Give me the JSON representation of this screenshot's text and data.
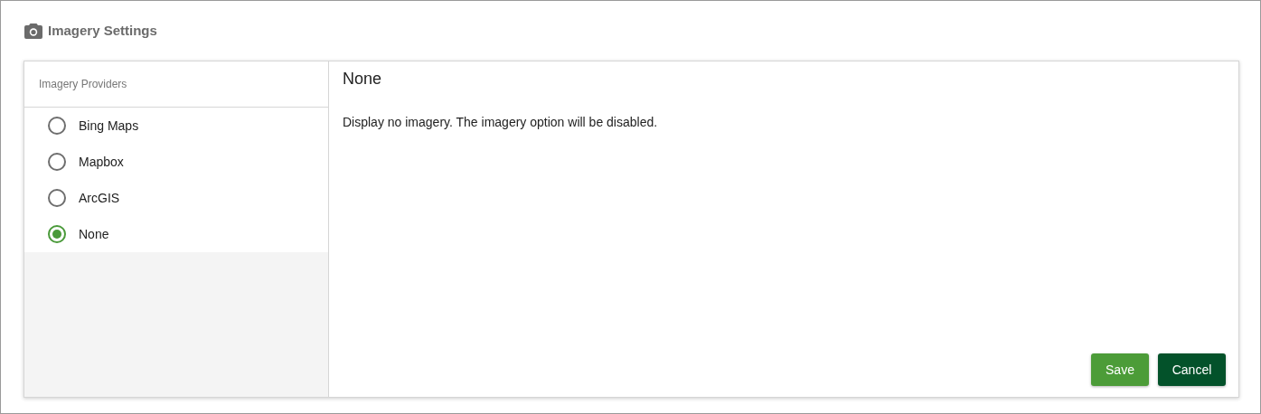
{
  "page": {
    "title": "Imagery Settings"
  },
  "sidebar": {
    "heading": "Imagery Providers",
    "items": [
      {
        "label": "Bing Maps",
        "selected": false
      },
      {
        "label": "Mapbox",
        "selected": false
      },
      {
        "label": "ArcGIS",
        "selected": false
      },
      {
        "label": "None",
        "selected": true
      }
    ]
  },
  "detail": {
    "title": "None",
    "description": "Display no imagery. The imagery option will be disabled."
  },
  "buttons": [
    {
      "label": "Save",
      "kind": "primary"
    },
    {
      "label": "Cancel",
      "kind": "secondary"
    }
  ]
}
